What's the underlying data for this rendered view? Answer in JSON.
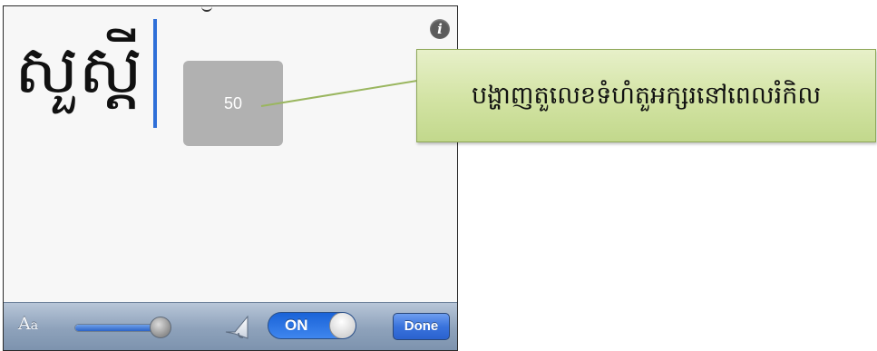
{
  "editor": {
    "text": "សួស្ដី"
  },
  "info_button": {
    "glyph": "i",
    "icon": "info-icon"
  },
  "font_size_popup": {
    "value": "50"
  },
  "toolbar": {
    "font_size_label_large": "A",
    "font_size_label_small": "a",
    "font_size_slider": {
      "level": 0.9,
      "accent": "#2c64c7"
    },
    "sound_icon": "speaker-icon",
    "sound_toggle": {
      "label": "ON",
      "state": "on",
      "accent": "#1a63d8"
    },
    "done_label": "Done"
  },
  "callout": {
    "text": "បង្ហាញតួលេខទំហំតួអក្សរនៅពេលរំកិល",
    "background": "#d2e3a3"
  }
}
